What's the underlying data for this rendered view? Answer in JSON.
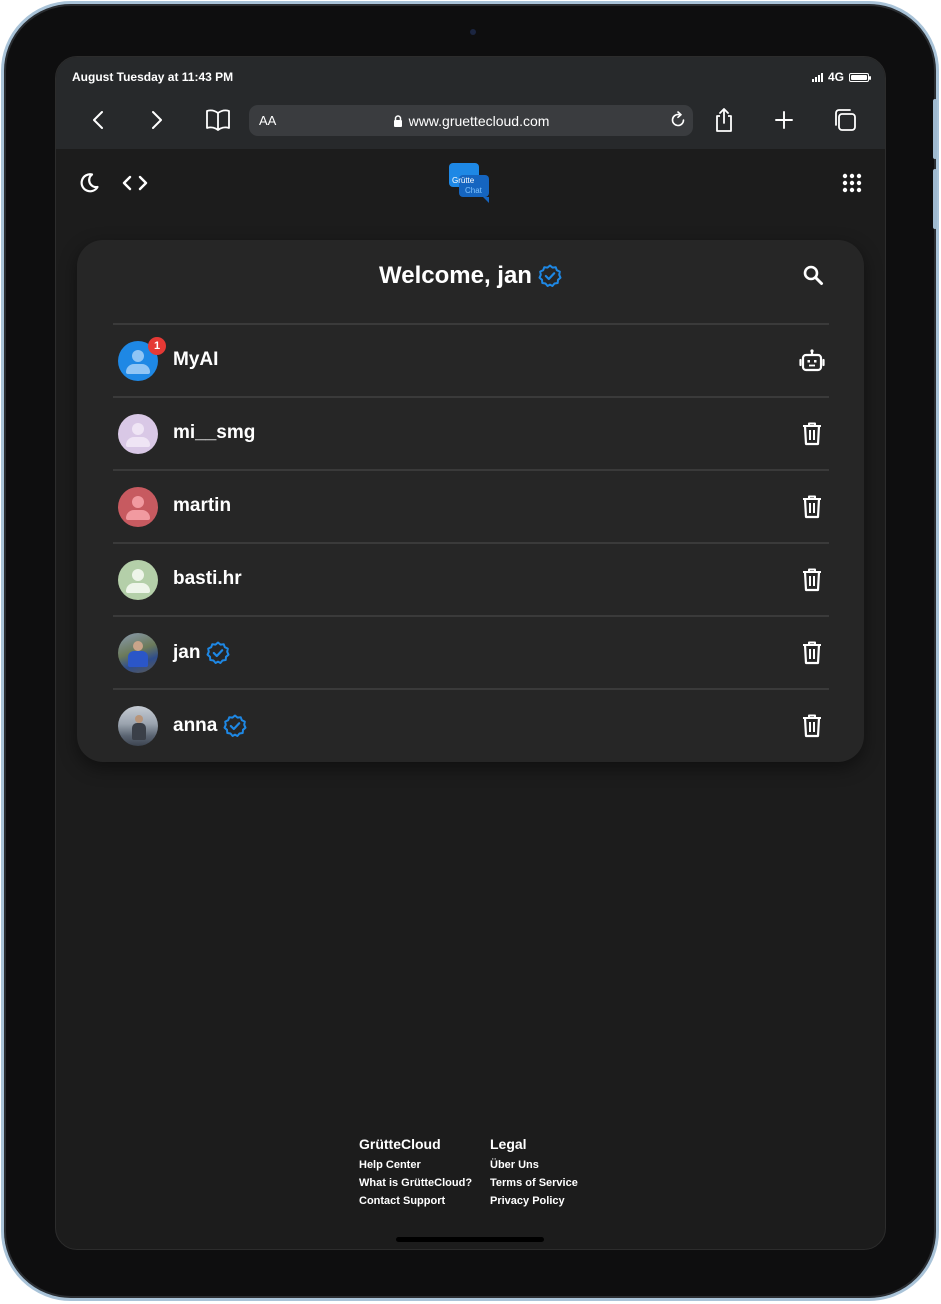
{
  "status_bar": {
    "time": "August Tuesday at 11:43 PM",
    "network": "4G"
  },
  "browser": {
    "text_size_label": "AA",
    "url": "www.gruettecloud.com"
  },
  "app": {
    "logo_text_top": "Grütte",
    "logo_text_bottom": "Chat",
    "accent_color": "#1e88e5"
  },
  "card": {
    "welcome_text": "Welcome, jan",
    "contacts": [
      {
        "name": "MyAI",
        "badge": "1",
        "verified": false,
        "action": "robot-icon"
      },
      {
        "name": "mi__smg",
        "verified": false,
        "action": "trash-icon"
      },
      {
        "name": "martin",
        "verified": false,
        "action": "trash-icon"
      },
      {
        "name": "basti.hr",
        "verified": false,
        "action": "trash-icon"
      },
      {
        "name": "jan",
        "verified": true,
        "action": "trash-icon"
      },
      {
        "name": "anna",
        "verified": true,
        "action": "trash-icon"
      }
    ]
  },
  "footer": {
    "col1": {
      "title": "GrütteCloud",
      "links": [
        "Help Center",
        "What is GrütteCloud?",
        "Contact Support"
      ]
    },
    "col2": {
      "title": "Legal",
      "links": [
        "Über Uns",
        "Terms of Service",
        "Privacy Policy"
      ]
    }
  }
}
